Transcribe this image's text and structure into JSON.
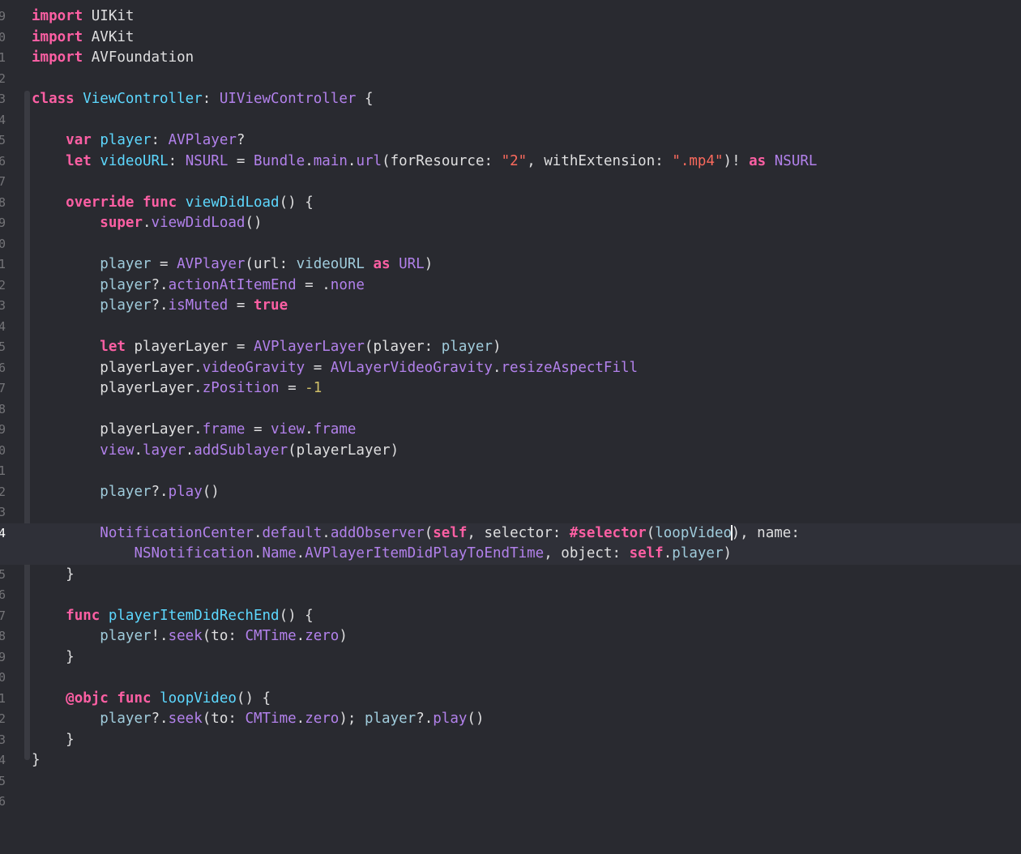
{
  "editor": {
    "language": "Swift",
    "theme": "dark",
    "colors": {
      "background": "#292a30",
      "keyword": "#fc5fa3",
      "string": "#fc6a5d",
      "number": "#d0bf69",
      "type_system": "#d0a8ff",
      "property_project": "#a0ccdc",
      "text": "#dfdfe0",
      "current_line": "#2f3038"
    },
    "current_line_number": "4",
    "lines": [
      {
        "num": "9",
        "tokens": [
          [
            "kw",
            "import"
          ],
          [
            "pl",
            " UIKit"
          ]
        ]
      },
      {
        "num": "0",
        "tokens": [
          [
            "kw",
            "import"
          ],
          [
            "pl",
            " AVKit"
          ]
        ]
      },
      {
        "num": "1",
        "tokens": [
          [
            "kw",
            "import"
          ],
          [
            "pl",
            " AVFoundation"
          ]
        ]
      },
      {
        "num": "2",
        "tokens": []
      },
      {
        "num": "3",
        "tokens": [
          [
            "kw",
            "class"
          ],
          [
            "pl",
            " "
          ],
          [
            "id",
            "ViewController"
          ],
          [
            "pl",
            ": "
          ],
          [
            "sys",
            "UIViewController"
          ],
          [
            "pl",
            " {"
          ]
        ]
      },
      {
        "num": "4",
        "tokens": []
      },
      {
        "num": "5",
        "tokens": [
          [
            "pl",
            "    "
          ],
          [
            "kw",
            "var"
          ],
          [
            "pl",
            " "
          ],
          [
            "id",
            "player"
          ],
          [
            "pl",
            ": "
          ],
          [
            "sys",
            "AVPlayer"
          ],
          [
            "pl",
            "?"
          ]
        ]
      },
      {
        "num": "6",
        "tokens": [
          [
            "pl",
            "    "
          ],
          [
            "kw",
            "let"
          ],
          [
            "pl",
            " "
          ],
          [
            "id",
            "videoURL"
          ],
          [
            "pl",
            ": "
          ],
          [
            "sys",
            "NSURL"
          ],
          [
            "pl",
            " = "
          ],
          [
            "sys",
            "Bundle"
          ],
          [
            "pl",
            "."
          ],
          [
            "sys",
            "main"
          ],
          [
            "pl",
            "."
          ],
          [
            "sys",
            "url"
          ],
          [
            "pl",
            "(forResource: "
          ],
          [
            "st",
            "\"2\""
          ],
          [
            "pl",
            ", withExtension: "
          ],
          [
            "st",
            "\".mp4\""
          ],
          [
            "pl",
            ")! "
          ],
          [
            "kw",
            "as"
          ],
          [
            "pl",
            " "
          ],
          [
            "sys",
            "NSURL"
          ]
        ]
      },
      {
        "num": "7",
        "tokens": []
      },
      {
        "num": "8",
        "tokens": [
          [
            "pl",
            "    "
          ],
          [
            "kw",
            "override"
          ],
          [
            "pl",
            " "
          ],
          [
            "kw",
            "func"
          ],
          [
            "pl",
            " "
          ],
          [
            "id",
            "viewDidLoad"
          ],
          [
            "pl",
            "() {"
          ]
        ]
      },
      {
        "num": "9",
        "tokens": [
          [
            "pl",
            "        "
          ],
          [
            "kw",
            "super"
          ],
          [
            "pl",
            "."
          ],
          [
            "sys",
            "viewDidLoad"
          ],
          [
            "pl",
            "()"
          ]
        ]
      },
      {
        "num": "0",
        "tokens": []
      },
      {
        "num": "1",
        "tokens": [
          [
            "pl",
            "        "
          ],
          [
            "prj",
            "player"
          ],
          [
            "pl",
            " = "
          ],
          [
            "sys",
            "AVPlayer"
          ],
          [
            "pl",
            "(url: "
          ],
          [
            "prj",
            "videoURL"
          ],
          [
            "pl",
            " "
          ],
          [
            "kw",
            "as"
          ],
          [
            "pl",
            " "
          ],
          [
            "sys",
            "URL"
          ],
          [
            "pl",
            ")"
          ]
        ]
      },
      {
        "num": "2",
        "tokens": [
          [
            "pl",
            "        "
          ],
          [
            "prj",
            "player"
          ],
          [
            "pl",
            "?."
          ],
          [
            "sys",
            "actionAtItemEnd"
          ],
          [
            "pl",
            " = ."
          ],
          [
            "sys",
            "none"
          ]
        ]
      },
      {
        "num": "3",
        "tokens": [
          [
            "pl",
            "        "
          ],
          [
            "prj",
            "player"
          ],
          [
            "pl",
            "?."
          ],
          [
            "sys",
            "isMuted"
          ],
          [
            "pl",
            " = "
          ],
          [
            "kw",
            "true"
          ]
        ]
      },
      {
        "num": "4",
        "tokens": []
      },
      {
        "num": "5",
        "tokens": [
          [
            "pl",
            "        "
          ],
          [
            "kw",
            "let"
          ],
          [
            "pl",
            " playerLayer = "
          ],
          [
            "sys",
            "AVPlayerLayer"
          ],
          [
            "pl",
            "(player: "
          ],
          [
            "prj",
            "player"
          ],
          [
            "pl",
            ")"
          ]
        ]
      },
      {
        "num": "6",
        "tokens": [
          [
            "pl",
            "        playerLayer."
          ],
          [
            "sys",
            "videoGravity"
          ],
          [
            "pl",
            " = "
          ],
          [
            "sys",
            "AVLayerVideoGravity"
          ],
          [
            "pl",
            "."
          ],
          [
            "sys",
            "resizeAspectFill"
          ]
        ]
      },
      {
        "num": "7",
        "tokens": [
          [
            "pl",
            "        playerLayer."
          ],
          [
            "sys",
            "zPosition"
          ],
          [
            "pl",
            " = "
          ],
          [
            "nm",
            "-1"
          ]
        ]
      },
      {
        "num": "8",
        "tokens": []
      },
      {
        "num": "9",
        "tokens": [
          [
            "pl",
            "        playerLayer."
          ],
          [
            "sys",
            "frame"
          ],
          [
            "pl",
            " = "
          ],
          [
            "sys",
            "view"
          ],
          [
            "pl",
            "."
          ],
          [
            "sys",
            "frame"
          ]
        ]
      },
      {
        "num": "0",
        "tokens": [
          [
            "pl",
            "        "
          ],
          [
            "sys",
            "view"
          ],
          [
            "pl",
            "."
          ],
          [
            "sys",
            "layer"
          ],
          [
            "pl",
            "."
          ],
          [
            "sys",
            "addSublayer"
          ],
          [
            "pl",
            "(playerLayer)"
          ]
        ]
      },
      {
        "num": "1",
        "tokens": []
      },
      {
        "num": "2",
        "tokens": [
          [
            "pl",
            "        "
          ],
          [
            "prj",
            "player"
          ],
          [
            "pl",
            "?."
          ],
          [
            "sys",
            "play"
          ],
          [
            "pl",
            "()"
          ]
        ]
      },
      {
        "num": "3",
        "tokens": []
      },
      {
        "num": "4",
        "current": true,
        "tokens": [
          [
            "pl",
            "        "
          ],
          [
            "sys",
            "NotificationCenter"
          ],
          [
            "pl",
            "."
          ],
          [
            "sys",
            "default"
          ],
          [
            "pl",
            "."
          ],
          [
            "sys",
            "addObserver"
          ],
          [
            "pl",
            "("
          ],
          [
            "kw",
            "self"
          ],
          [
            "pl",
            ", selector: "
          ],
          [
            "kw",
            "#selector"
          ],
          [
            "pl",
            "("
          ],
          [
            "prj",
            "loopVideo"
          ],
          [
            "cursor",
            ""
          ],
          [
            "pl",
            "), name:"
          ]
        ]
      },
      {
        "num": "",
        "current": true,
        "tokens": [
          [
            "pl",
            "            "
          ],
          [
            "sys",
            "NSNotification"
          ],
          [
            "pl",
            "."
          ],
          [
            "sys",
            "Name"
          ],
          [
            "pl",
            "."
          ],
          [
            "sys",
            "AVPlayerItemDidPlayToEndTime"
          ],
          [
            "pl",
            ", object: "
          ],
          [
            "kw",
            "self"
          ],
          [
            "pl",
            "."
          ],
          [
            "prj",
            "player"
          ],
          [
            "pl",
            ")"
          ]
        ]
      },
      {
        "num": "5",
        "tokens": [
          [
            "pl",
            "    }"
          ]
        ]
      },
      {
        "num": "6",
        "tokens": []
      },
      {
        "num": "7",
        "tokens": [
          [
            "pl",
            "    "
          ],
          [
            "kw",
            "func"
          ],
          [
            "pl",
            " "
          ],
          [
            "id",
            "playerItemDidRechEnd"
          ],
          [
            "pl",
            "() {"
          ]
        ]
      },
      {
        "num": "8",
        "tokens": [
          [
            "pl",
            "        "
          ],
          [
            "prj",
            "player"
          ],
          [
            "pl",
            "!."
          ],
          [
            "sys",
            "seek"
          ],
          [
            "pl",
            "(to: "
          ],
          [
            "sys",
            "CMTime"
          ],
          [
            "pl",
            "."
          ],
          [
            "sys",
            "zero"
          ],
          [
            "pl",
            ")"
          ]
        ]
      },
      {
        "num": "9",
        "tokens": [
          [
            "pl",
            "    }"
          ]
        ]
      },
      {
        "num": "0",
        "tokens": []
      },
      {
        "num": "1",
        "tokens": [
          [
            "pl",
            "    "
          ],
          [
            "kw",
            "@objc"
          ],
          [
            "pl",
            " "
          ],
          [
            "kw",
            "func"
          ],
          [
            "pl",
            " "
          ],
          [
            "id",
            "loopVideo"
          ],
          [
            "pl",
            "() {"
          ]
        ]
      },
      {
        "num": "2",
        "tokens": [
          [
            "pl",
            "        "
          ],
          [
            "prj",
            "player"
          ],
          [
            "pl",
            "?."
          ],
          [
            "sys",
            "seek"
          ],
          [
            "pl",
            "(to: "
          ],
          [
            "sys",
            "CMTime"
          ],
          [
            "pl",
            "."
          ],
          [
            "sys",
            "zero"
          ],
          [
            "pl",
            "); "
          ],
          [
            "prj",
            "player"
          ],
          [
            "pl",
            "?."
          ],
          [
            "sys",
            "play"
          ],
          [
            "pl",
            "()"
          ]
        ]
      },
      {
        "num": "3",
        "tokens": [
          [
            "pl",
            "    }"
          ]
        ]
      },
      {
        "num": "4",
        "tokens": [
          [
            "pl",
            "}"
          ]
        ]
      },
      {
        "num": "5",
        "tokens": []
      },
      {
        "num": "6",
        "tokens": []
      }
    ]
  }
}
